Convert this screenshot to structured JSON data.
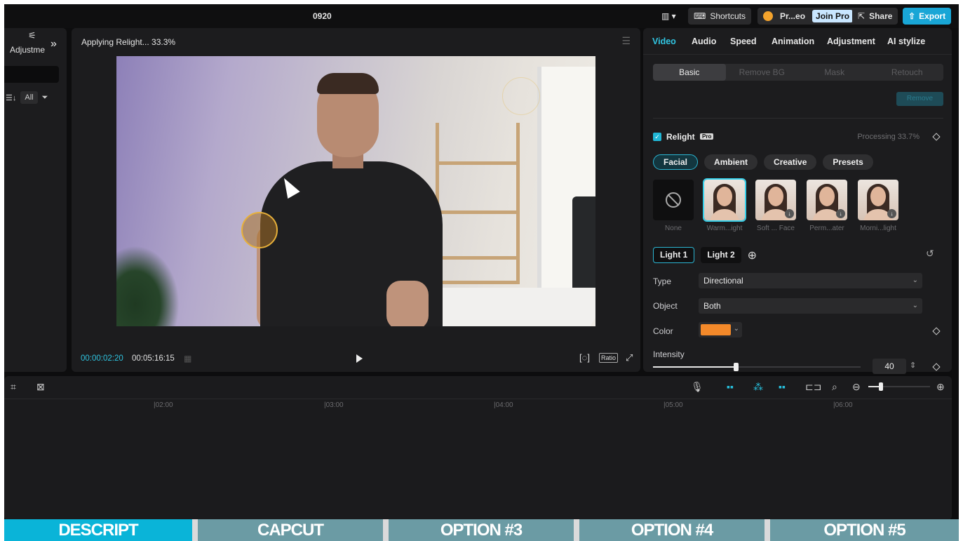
{
  "titlebar": {
    "project_name": "0920",
    "layout_icon": "layout-icon",
    "shortcuts_label": "Shortcuts",
    "account_label": "Pr...eo",
    "join_pro_label": "Join Pro",
    "share_label": "Share",
    "export_label": "Export",
    "accent_color": "#19a6d6"
  },
  "left_panel": {
    "title": "Adjustme",
    "filter_all": "All",
    "collapse_icon": "double-chevron-right-icon"
  },
  "player": {
    "status": "Applying Relight... 33.3%",
    "current_time": "00:00:02:20",
    "duration": "00:05:16:15",
    "ratio_label": "Ratio"
  },
  "right_panel": {
    "tabs": [
      {
        "label": "Video",
        "active": true
      },
      {
        "label": "Audio",
        "active": false
      },
      {
        "label": "Speed",
        "active": false
      },
      {
        "label": "Animation",
        "active": false
      },
      {
        "label": "Adjustment",
        "active": false
      },
      {
        "label": "AI stylize",
        "active": false
      }
    ],
    "subtabs": [
      {
        "label": "Basic",
        "active": true
      },
      {
        "label": "Remove BG",
        "active": false
      },
      {
        "label": "Mask",
        "active": false
      },
      {
        "label": "Retouch",
        "active": false
      }
    ],
    "remove_button_label": "Remove",
    "relight": {
      "label": "Relight",
      "badge": "Pro",
      "checked": true,
      "processing": "Processing 33.7%"
    },
    "categories": [
      {
        "label": "Facial",
        "active": true
      },
      {
        "label": "Ambient",
        "active": false
      },
      {
        "label": "Creative",
        "active": false
      },
      {
        "label": "Presets",
        "active": false
      }
    ],
    "presets": [
      {
        "caption": "None",
        "selected": false
      },
      {
        "caption": "Warm...ight",
        "selected": true
      },
      {
        "caption": "Soft ... Face",
        "selected": false
      },
      {
        "caption": "Perm...ater",
        "selected": false
      },
      {
        "caption": "Morni...light",
        "selected": false
      }
    ],
    "lights": [
      {
        "label": "Light 1",
        "active": true
      },
      {
        "label": "Light 2",
        "active": false
      }
    ],
    "type_label": "Type",
    "type_value": "Directional",
    "object_label": "Object",
    "object_value": "Both",
    "color_label": "Color",
    "color_value": "#f3892a",
    "intensity_label": "Intensity",
    "intensity_value": "40",
    "intensity_fraction": 0.4,
    "accent_color": "#31c5e2"
  },
  "timeline": {
    "ticks": [
      "|02:00",
      "|03:00",
      "|04:00",
      "|05:00",
      "|06:00"
    ],
    "zoom_fraction": 0.2
  },
  "overlay": {
    "labels": [
      "DESCRIPT",
      "CAPCUT",
      "OPTION #3",
      "OPTION #4",
      "OPTION #5"
    ],
    "highlight_color": "#0ab4d8"
  }
}
